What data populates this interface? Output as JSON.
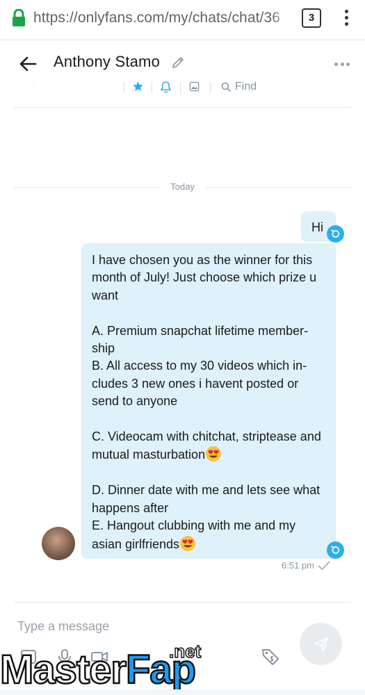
{
  "browser": {
    "url": "https://onlyfans.com/my/chats/chat/36",
    "tab_count": "3"
  },
  "header": {
    "contact_name": "Anthony Stamo",
    "find_label": "Find",
    "tool_dot": "."
  },
  "messages": {
    "date_label": "Today",
    "hi_text": "Hi",
    "main_text_1": "I have chosen you as the winner for this month of July! Just choose which prize u want\n\nA. Premium snapchat lifetime member-ship\nB. All access to my 30 videos which in-cludes 3 new ones i havent posted or send to anyone\n\nC. Videocam with chitchat, striptease and mutual masturbation",
    "main_text_2": "\n\nD. Dinner date with me and lets see what happens after\nE. Hangout clubbing with me and my asian girlfriends",
    "time": "6:51 pm"
  },
  "composer": {
    "placeholder": "Type a message"
  },
  "watermark": {
    "part1": "Master",
    "part2": "Fap",
    "part3": ".net"
  },
  "colors": {
    "accent": "#2aaef0",
    "bubble": "#dff1fb",
    "muted": "#8a96a3"
  }
}
